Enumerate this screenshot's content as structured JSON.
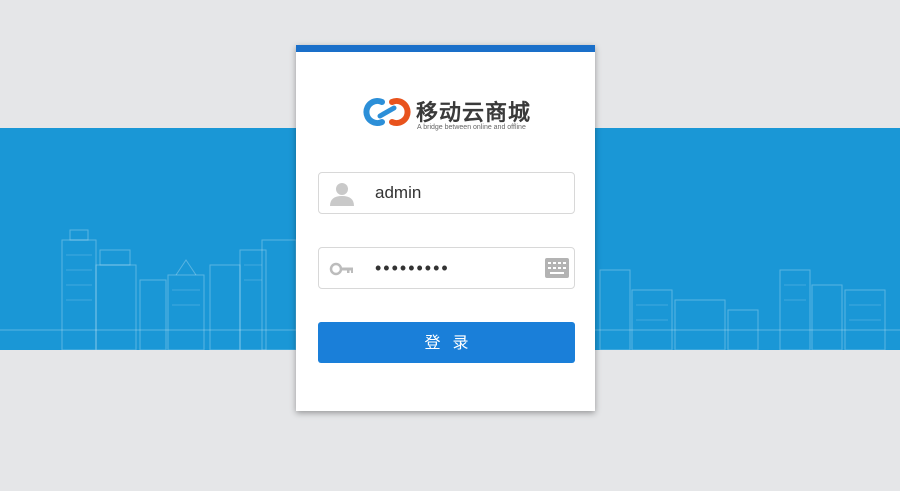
{
  "brand": {
    "name": "移动云商城",
    "slogan": "A bridge between online and offline",
    "colors": {
      "primary": "#1a7fd9",
      "band": "#1a97d6",
      "logo_orange": "#e8531d",
      "logo_blue": "#2c8fd8"
    }
  },
  "login": {
    "username_icon": "user-icon",
    "username_value": "admin",
    "password_icon": "key-icon",
    "password_value": "•••••••••",
    "keyboard_icon": "keyboard-icon",
    "submit_label": "登录"
  }
}
